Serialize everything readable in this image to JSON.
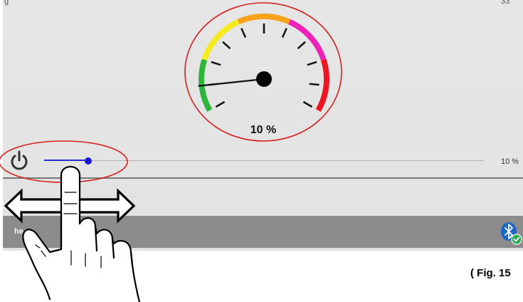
{
  "top_bar": {
    "left_text": "g",
    "right_text": "33"
  },
  "gauge": {
    "value_percent": 10,
    "value_label": "10 %",
    "zone_colors": [
      "#2db53a",
      "#f7ea1e",
      "#f7a41c",
      "#ee22b9",
      "#f0141e"
    ],
    "highlight_color": "#d81e1e"
  },
  "control": {
    "power_icon": "power-icon",
    "slider_value_fraction": 0.1,
    "slider_percent_label": "10 %",
    "slider_color": "#1a1ad4"
  },
  "bottom_bar": {
    "label": "he",
    "icon": "bluetooth-connected-icon",
    "bt_color": "#1a66c8",
    "check_color": "#2fa84f"
  },
  "gesture": {
    "icon": "hand-swipe-icon",
    "arrow": "double-arrow-icon"
  },
  "caption": "( Fig. 15"
}
